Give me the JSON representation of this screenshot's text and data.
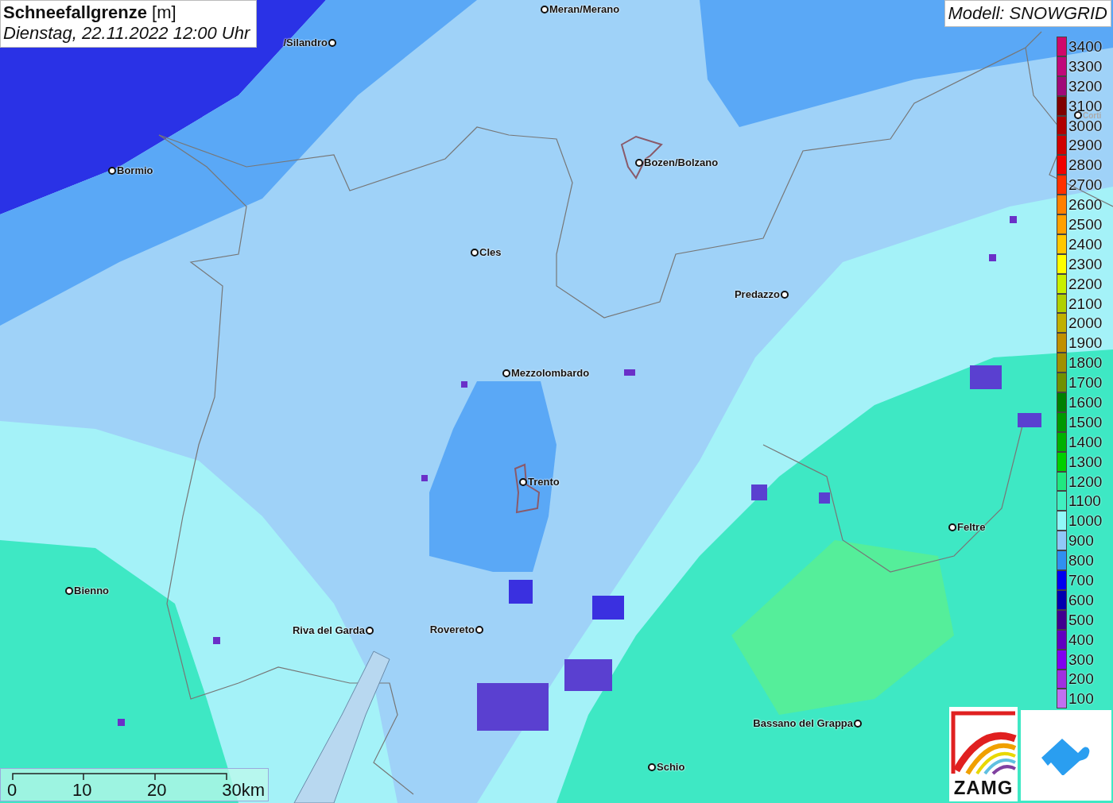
{
  "title": {
    "name": "Schneefallgrenze",
    "unit": "[m]",
    "date": "Dienstag, 22.11.2022 12:00 Uhr"
  },
  "model": "Modell: SNOWGRID",
  "places": [
    "Meran/Merano",
    "/Silandro",
    "Bormio",
    "Bozen/Bolzano",
    "Cles",
    "Predazzo",
    "Mezzolombardo",
    "Trento",
    "Feltre",
    "Bienno",
    "Riva del Garda",
    "Rovereto",
    "Bassano del Grappa",
    "Schio",
    "Corti"
  ],
  "legend": [
    {
      "label": "3400",
      "color": "#d0086a"
    },
    {
      "label": "3300",
      "color": "#c0087a"
    },
    {
      "label": "3200",
      "color": "#a00878"
    },
    {
      "label": "3100",
      "color": "#800000"
    },
    {
      "label": "3000",
      "color": "#b00000"
    },
    {
      "label": "2900",
      "color": "#d00000"
    },
    {
      "label": "2800",
      "color": "#f00000"
    },
    {
      "label": "2700",
      "color": "#ff3000"
    },
    {
      "label": "2600",
      "color": "#ff8000"
    },
    {
      "label": "2500",
      "color": "#ffa000"
    },
    {
      "label": "2400",
      "color": "#ffc800"
    },
    {
      "label": "2300",
      "color": "#ffff00"
    },
    {
      "label": "2200",
      "color": "#c8f000"
    },
    {
      "label": "2100",
      "color": "#b0d000"
    },
    {
      "label": "2000",
      "color": "#c0b000"
    },
    {
      "label": "1900",
      "color": "#c09000"
    },
    {
      "label": "1800",
      "color": "#a09000"
    },
    {
      "label": "1700",
      "color": "#709000"
    },
    {
      "label": "1600",
      "color": "#008000"
    },
    {
      "label": "1500",
      "color": "#009800"
    },
    {
      "label": "1400",
      "color": "#00b000"
    },
    {
      "label": "1300",
      "color": "#00d000"
    },
    {
      "label": "1200",
      "color": "#20e880"
    },
    {
      "label": "1100",
      "color": "#40f0c0"
    },
    {
      "label": "1000",
      "color": "#90f8f8"
    },
    {
      "label": "900",
      "color": "#90c8f8"
    },
    {
      "label": "800",
      "color": "#3090f0"
    },
    {
      "label": "700",
      "color": "#0000f0"
    },
    {
      "label": "600",
      "color": "#0000b0"
    },
    {
      "label": "500",
      "color": "#400090"
    },
    {
      "label": "400",
      "color": "#6000c0"
    },
    {
      "label": "300",
      "color": "#8000f0"
    },
    {
      "label": "200",
      "color": "#a030e0"
    },
    {
      "label": "100",
      "color": "#c070f0"
    }
  ],
  "scale": [
    "0",
    "10",
    "20",
    "30km"
  ],
  "logo_text": "ZAMG"
}
